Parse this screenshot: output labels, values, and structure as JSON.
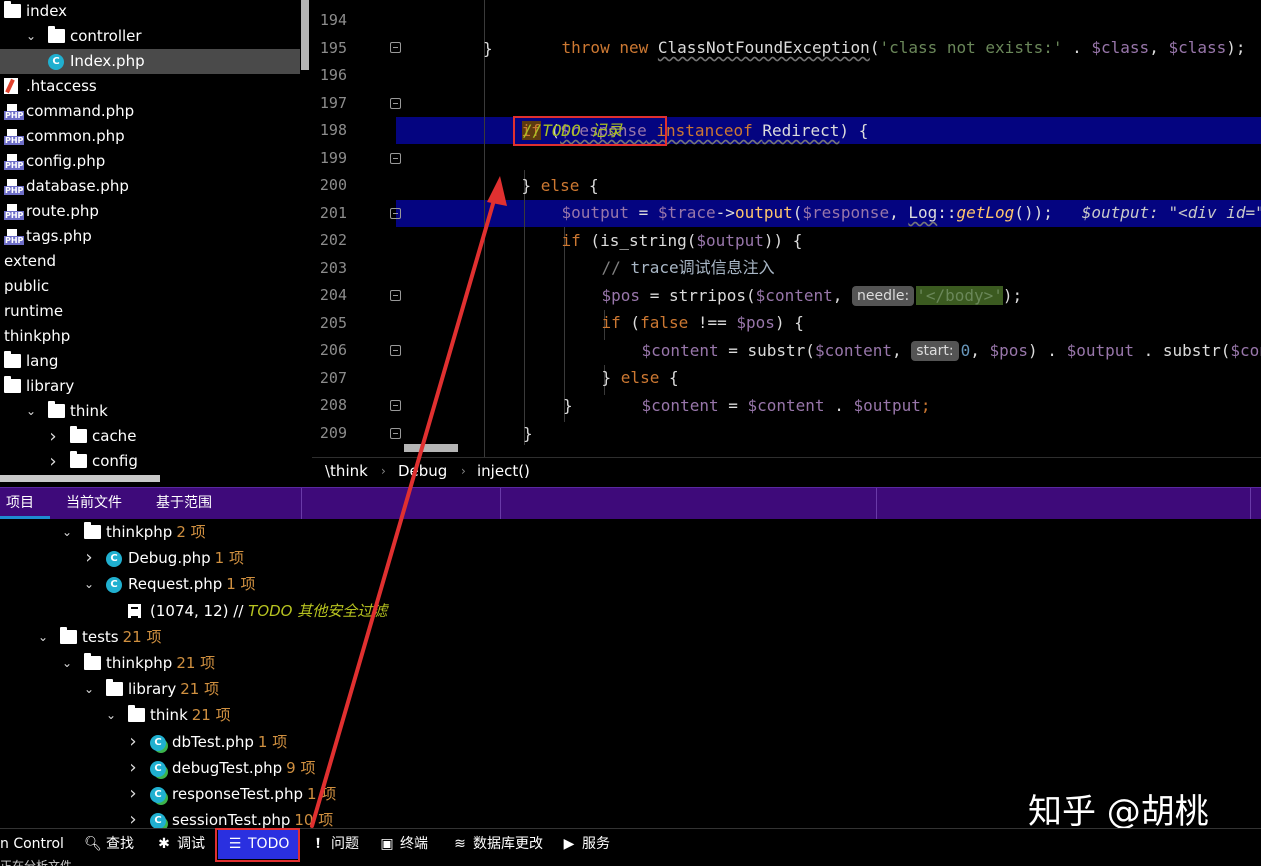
{
  "project_tree": {
    "items": [
      {
        "label": "index",
        "icon": "folder-icon",
        "level": 0,
        "arrow": ""
      },
      {
        "label": "controller",
        "icon": "folder-icon",
        "level": 1,
        "arrow": "v"
      },
      {
        "label": "Index.php",
        "icon": "php-class-icon",
        "level": 2,
        "arrow": "",
        "selected": true
      },
      {
        "label": ".htaccess",
        "icon": "htaccess-file-icon",
        "level": 0,
        "arrow": ""
      },
      {
        "label": "command.php",
        "icon": "php-file-icon",
        "level": 0,
        "arrow": ""
      },
      {
        "label": "common.php",
        "icon": "php-file-icon",
        "level": 0,
        "arrow": ""
      },
      {
        "label": "config.php",
        "icon": "php-file-icon",
        "level": 0,
        "arrow": ""
      },
      {
        "label": "database.php",
        "icon": "php-file-icon",
        "level": 0,
        "arrow": ""
      },
      {
        "label": "route.php",
        "icon": "php-file-icon",
        "level": 0,
        "arrow": ""
      },
      {
        "label": "tags.php",
        "icon": "php-file-icon",
        "level": 0,
        "arrow": ""
      },
      {
        "label": "extend",
        "icon": "",
        "level": 0,
        "arrow": ""
      },
      {
        "label": "public",
        "icon": "",
        "level": 0,
        "arrow": ""
      },
      {
        "label": "runtime",
        "icon": "",
        "level": 0,
        "arrow": ""
      },
      {
        "label": "thinkphp",
        "icon": "",
        "level": 0,
        "arrow": ""
      },
      {
        "label": "lang",
        "icon": "folder-icon",
        "level": 0,
        "arrow": ""
      },
      {
        "label": "library",
        "icon": "folder-icon",
        "level": 0,
        "arrow": ""
      },
      {
        "label": "think",
        "icon": "folder-icon",
        "level": 1,
        "arrow": "v"
      },
      {
        "label": "cache",
        "icon": "folder-icon",
        "level": 2,
        "arrow": ">"
      },
      {
        "label": "config",
        "icon": "folder-icon",
        "level": 2,
        "arrow": ">"
      }
    ]
  },
  "editor": {
    "line_numbers": [
      "194",
      "195",
      "196",
      "197",
      "198",
      "199",
      "200",
      "201",
      "202",
      "203",
      "204",
      "205",
      "206",
      "207",
      "208",
      "209"
    ],
    "code": {
      "l194": {
        "throw": "throw",
        "new": "new",
        "cls": "ClassNotFoundException",
        "p1": "(",
        "msg": "'class not exists:'",
        "dot": " . ",
        "v1": "$class",
        "comma": ", ",
        "v2": "$class",
        "end": ");"
      },
      "l195": {
        "brace": "}"
      },
      "l197": {
        "if": "if",
        "p": " (",
        "v": "$response",
        "inst": " instanceof ",
        "cls": "Redirect",
        "end": ") {"
      },
      "l198": {
        "todo": "//TODO 记录"
      },
      "l199": {
        "b": "} ",
        "else": "else",
        "end": " {"
      },
      "l200": {
        "v1": "$output",
        "eq": " = ",
        "v2": "$trace",
        "arrow": "->",
        "fn": "output",
        "p": "(",
        "v3": "$response",
        "c": ", ",
        "log": "Log",
        "dc": "::",
        "fn2": "getLog",
        "end": "());",
        "inline": "$output: \"<div id=\"th"
      },
      "l201": {
        "if": "if",
        "p": " (",
        "fn": "is_string",
        "p2": "(",
        "v": "$output",
        "end": ")) {"
      },
      "l202": {
        "cm1": "// ",
        "cm2": "trace调试信息注入"
      },
      "l203": {
        "v": "$pos",
        "eq": " = ",
        "fn": "strripos",
        "p": "(",
        "v2": "$content",
        "c": ", ",
        "hint": "needle:",
        "str": "'</body>'",
        "end": ");"
      },
      "l204": {
        "if": "if",
        "p": " (",
        "false": "false",
        "op": " !== ",
        "v": "$pos",
        "end": ") {"
      },
      "l205": {
        "v": "$content",
        "eq": " = ",
        "fn": "substr",
        "p": "(",
        "v2": "$content",
        "c": ", ",
        "hint": "start:",
        "num": "0",
        "c2": ", ",
        "v3": "$pos",
        "m": ") . ",
        "v4": "$output",
        "m2": " . ",
        "fn2": "substr",
        "p2": "(",
        "v5": "$cont"
      },
      "l206": {
        "b": "} ",
        "else": "else",
        "end": " {"
      },
      "l207": {
        "v": "$content",
        "eq": " = ",
        "v2": "$content",
        "dot": " . ",
        "v3": "$output",
        "end": ";"
      },
      "l208": {
        "brace": "}"
      },
      "l209": {
        "brace": "}"
      }
    }
  },
  "breadcrumb": {
    "items": [
      "\\think",
      "Debug",
      "inject()"
    ],
    "separator": "›"
  },
  "todo_panel": {
    "tabs": [
      "项目",
      "当前文件",
      "基于范围"
    ],
    "active_tab": "项目",
    "rows": [
      {
        "name": "thinkphp",
        "count": "2 项",
        "icon": "folder-icon",
        "arrow": "v",
        "indent": 62
      },
      {
        "name": "Debug.php",
        "count": "1 项",
        "icon": "php-class-icon",
        "arrow": ">",
        "indent": 84
      },
      {
        "name": "Request.php",
        "count": "1 项",
        "icon": "php-class-icon",
        "arrow": "v",
        "indent": 84
      },
      {
        "name": "(1074, 12) // ",
        "todo": "TODO 其他安全过滤",
        "icon": "todo-item-icon",
        "arrow": "",
        "indent": 106
      },
      {
        "name": "tests",
        "count": "21 项",
        "icon": "folder-icon",
        "arrow": "v",
        "indent": 38
      },
      {
        "name": "thinkphp",
        "count": "21 项",
        "icon": "folder-icon",
        "arrow": "v",
        "indent": 62
      },
      {
        "name": "library",
        "count": "21 项",
        "icon": "folder-icon",
        "arrow": "v",
        "indent": 84
      },
      {
        "name": "think",
        "count": "21 项",
        "icon": "folder-icon",
        "arrow": "v",
        "indent": 106
      },
      {
        "name": "dbTest.php",
        "count": "1 项",
        "icon": "php-test-class-icon",
        "arrow": ">",
        "indent": 128
      },
      {
        "name": "debugTest.php",
        "count": "9 项",
        "icon": "php-test-class-icon",
        "arrow": ">",
        "indent": 128
      },
      {
        "name": "responseTest.php",
        "count": "1 项",
        "icon": "php-test-class-icon",
        "arrow": ">",
        "indent": 128
      },
      {
        "name": "sessionTest.php",
        "count": "10 项",
        "icon": "php-test-class-icon",
        "arrow": ">",
        "indent": 128
      }
    ]
  },
  "watermark": "知乎 @胡桃",
  "toolbar": {
    "items": [
      {
        "label": "n Control",
        "icon": "",
        "name": "version-control-tool"
      },
      {
        "label": "查找",
        "icon": "search-icon",
        "name": "find-tool"
      },
      {
        "label": "调试",
        "icon": "bug-icon",
        "name": "debug-tool"
      },
      {
        "label": "TODO",
        "icon": "list-icon",
        "name": "todo-tool",
        "active": true
      },
      {
        "label": "问题",
        "icon": "problems-icon",
        "name": "problems-tool"
      },
      {
        "label": "终端",
        "icon": "terminal-icon",
        "name": "terminal-tool"
      },
      {
        "label": "数据库更改",
        "icon": "database-icon",
        "name": "database-changes-tool"
      },
      {
        "label": "服务",
        "icon": "services-icon",
        "name": "services-tool"
      }
    ]
  },
  "status_bar": {
    "text": "正在分析文件"
  },
  "colors": {
    "accent": "#2a30e0",
    "panel_header": "#3e0a7a",
    "annotation": "#e03030",
    "line_highlight": "#040480"
  }
}
